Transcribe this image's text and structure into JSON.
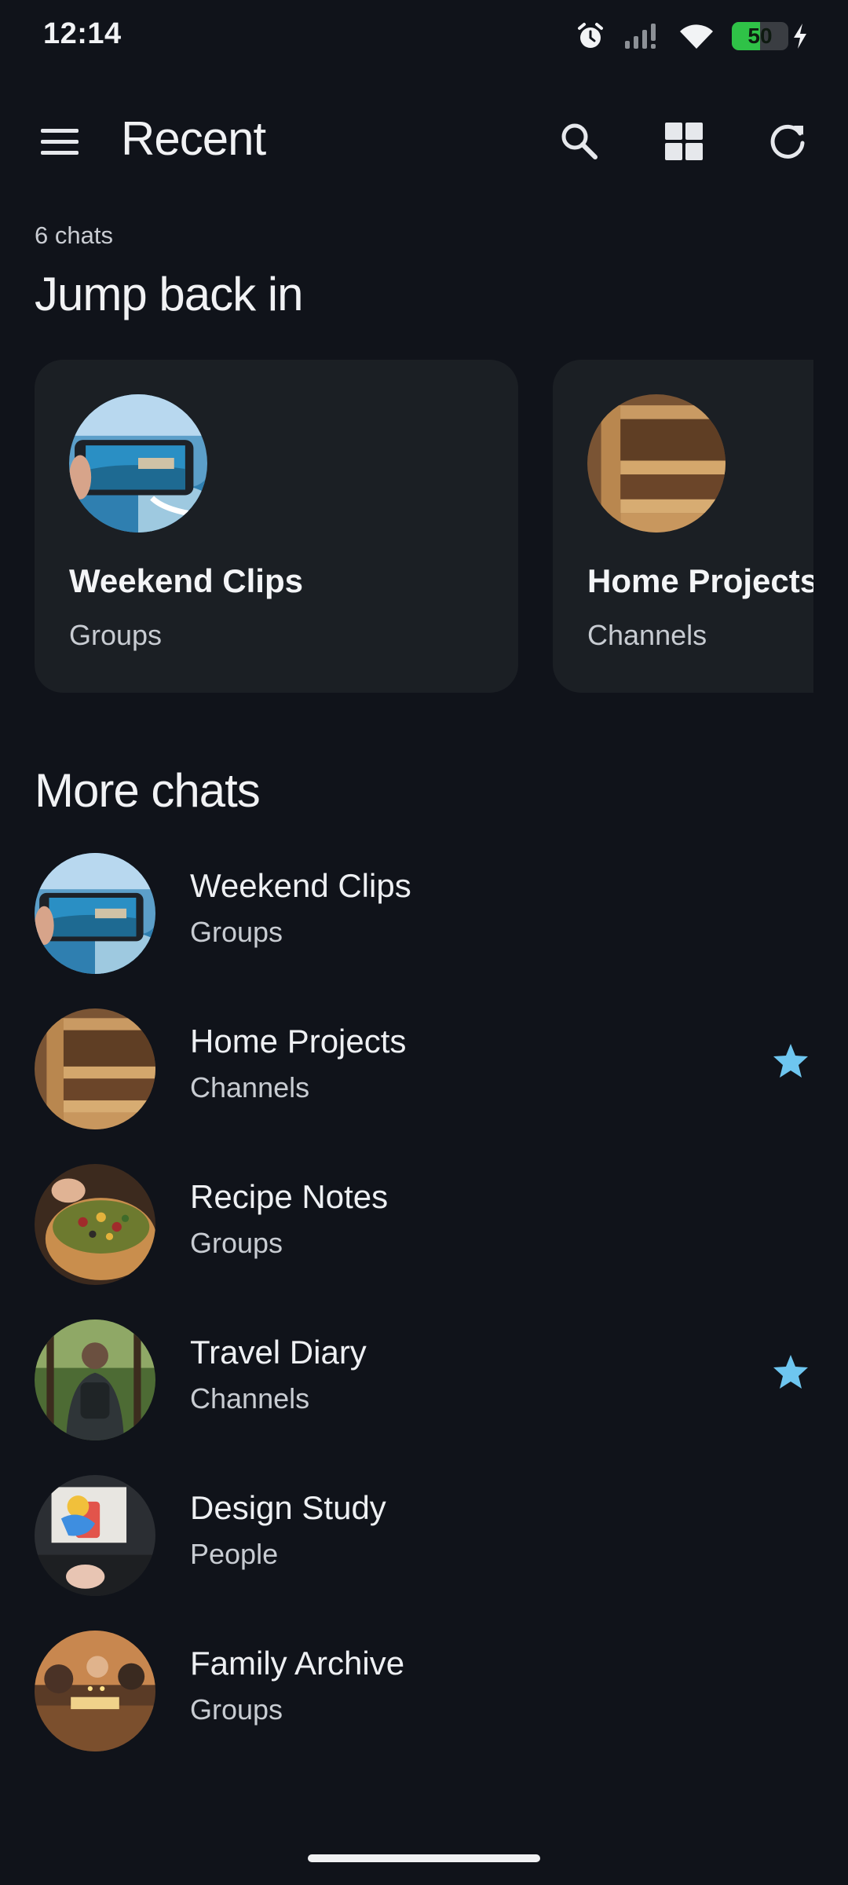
{
  "status_bar": {
    "time": "12:14",
    "battery_level": "50",
    "battery_fraction": 0.5,
    "icons": [
      "alarm-icon",
      "signal-icon",
      "wifi-icon",
      "battery-icon",
      "charging-icon"
    ]
  },
  "app_bar": {
    "title": "Recent",
    "icons": [
      "menu-icon",
      "search-icon",
      "grid-icon",
      "refresh-icon"
    ]
  },
  "summary": {
    "count_label": "6 chats"
  },
  "jump_back": {
    "title": "Jump back in",
    "cards": [
      {
        "title": "Weekend Clips",
        "subtitle": "Groups"
      },
      {
        "title": "Home Projects",
        "subtitle": "Channels"
      }
    ]
  },
  "more_chats": {
    "title": "More chats",
    "items": [
      {
        "title": "Weekend Clips",
        "subtitle": "Groups",
        "starred": false
      },
      {
        "title": "Home Projects",
        "subtitle": "Channels",
        "starred": true
      },
      {
        "title": "Recipe Notes",
        "subtitle": "Groups",
        "starred": false
      },
      {
        "title": "Travel Diary",
        "subtitle": "Channels",
        "starred": true
      },
      {
        "title": "Design Study",
        "subtitle": "People",
        "starred": false
      },
      {
        "title": "Family Archive",
        "subtitle": "Groups",
        "starred": false
      }
    ]
  },
  "colors": {
    "background": "#10131a",
    "card": "#1b1f24",
    "star": "#6ec6f0",
    "battery": "#2fc247"
  }
}
